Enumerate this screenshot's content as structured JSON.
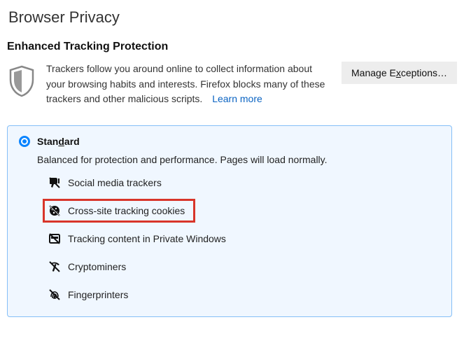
{
  "page_title": "Browser Privacy",
  "section_heading": "Enhanced Tracking Protection",
  "description": "Trackers follow you around online to collect information about your browsing habits and interests. Firefox blocks many of these trackers and other malicious scripts.",
  "learn_more": "Learn more",
  "manage_exceptions_prefix": "Manage E",
  "manage_exceptions_ul": "x",
  "manage_exceptions_suffix": "ceptions…",
  "standard": {
    "title_prefix": "Stan",
    "title_ul": "d",
    "title_suffix": "ard",
    "desc": "Balanced for protection and performance. Pages will load normally.",
    "trackers": [
      {
        "label": "Social media trackers",
        "icon": "social"
      },
      {
        "label": "Cross-site tracking cookies",
        "icon": "cookie",
        "highlighted": true
      },
      {
        "label": "Tracking content in Private Windows",
        "icon": "content"
      },
      {
        "label": "Cryptominers",
        "icon": "crypto"
      },
      {
        "label": "Fingerprinters",
        "icon": "fingerprint"
      }
    ]
  }
}
